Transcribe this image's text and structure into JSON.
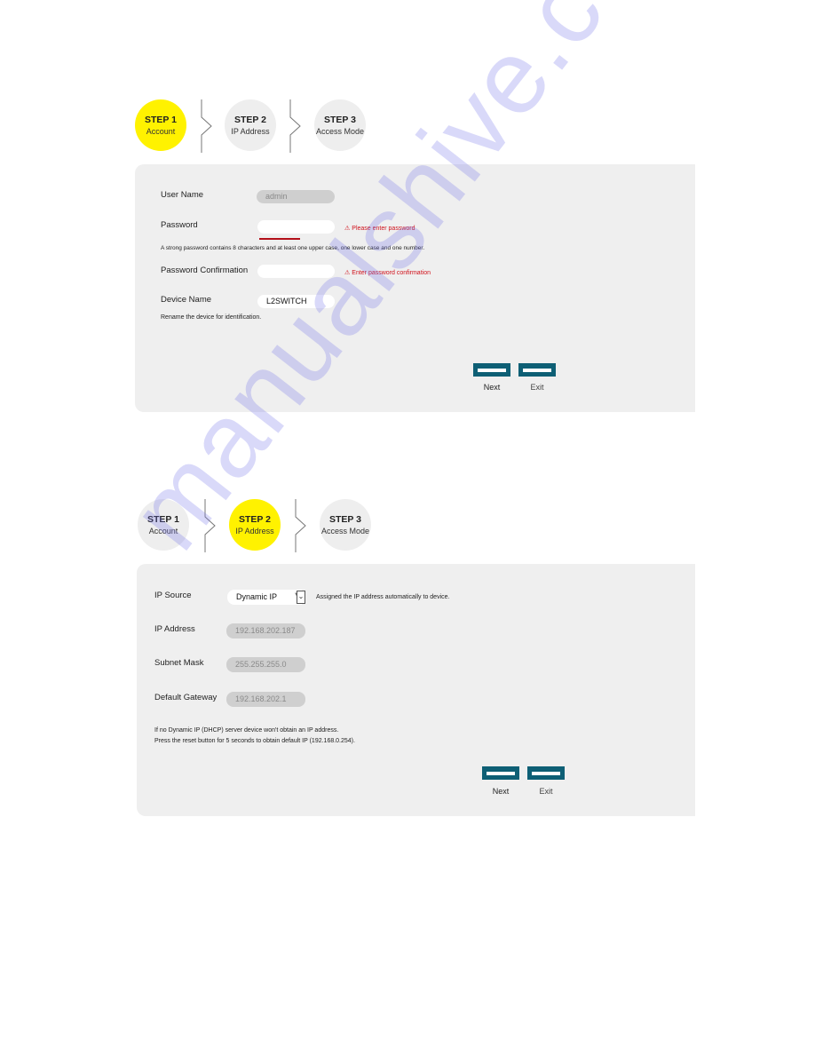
{
  "colors": {
    "active_step": "#fff200",
    "inactive_step": "#eeeeee",
    "panel_bg": "#efefef",
    "button": "#0e5f75",
    "error": "#d0101a"
  },
  "wizard_account": {
    "steps": [
      {
        "num": "STEP 1",
        "name": "Account",
        "active": true
      },
      {
        "num": "STEP 2",
        "name": "IP Address",
        "active": false
      },
      {
        "num": "STEP 3",
        "name": "Access Mode",
        "active": false
      }
    ],
    "fields": {
      "user_name": {
        "label": "User Name",
        "value": "admin"
      },
      "password": {
        "label": "Password",
        "value": "",
        "error": "Please enter password"
      },
      "password_hint": "A strong password contains 8 characters and at least one upper case, one lower case and one number.",
      "password_confirmation": {
        "label": "Password Confirmation",
        "value": "",
        "error": "Enter password confirmation"
      },
      "device_name": {
        "label": "Device Name",
        "value": "L2SWITCH"
      },
      "device_hint": "Rename the device for identification."
    },
    "buttons": {
      "next": "Next",
      "exit": "Exit"
    }
  },
  "wizard_ip": {
    "steps": [
      {
        "num": "STEP 1",
        "name": "Account",
        "active": false
      },
      {
        "num": "STEP 2",
        "name": "IP Address",
        "active": true
      },
      {
        "num": "STEP 3",
        "name": "Access Mode",
        "active": false
      }
    ],
    "fields": {
      "ip_source": {
        "label": "IP Source",
        "value": "Dynamic IP",
        "hint": "Assigned the IP address automatically to device."
      },
      "ip_address": {
        "label": "IP Address",
        "value": "192.168.202.187"
      },
      "subnet_mask": {
        "label": "Subnet Mask",
        "value": "255.255.255.0"
      },
      "default_gateway": {
        "label": "Default Gateway",
        "value": "192.168.202.1"
      },
      "note_line1": "If no Dynamic IP (DHCP) server device won't obtain an IP address.",
      "note_line2": "Press the reset button for 5 seconds to obtain default IP (192.168.0.254)."
    },
    "buttons": {
      "next": "Next",
      "exit": "Exit"
    }
  },
  "watermark": "manualshive.com",
  "icons": {
    "warning": "⚠",
    "dropdown": "⌄",
    "chevron_separator": "chevron-right"
  }
}
